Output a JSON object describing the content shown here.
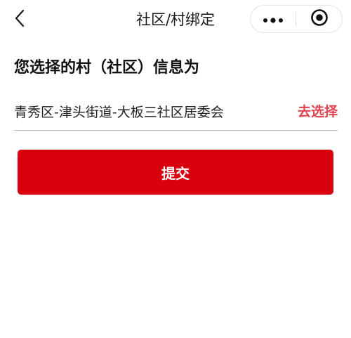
{
  "navbar": {
    "title": "社区/村绑定",
    "back_icon": "chevron-left-icon",
    "more_icon": "more-dots-icon",
    "close_icon": "target-circle-icon"
  },
  "binding": {
    "heading": "您选择的村（社区）信息为",
    "selected_value": "青秀区-津头街道-大板三社区居委会",
    "select_link": "去选择",
    "submit_label": "提交"
  },
  "colors": {
    "accent_red": "#d9000f",
    "link_red": "#e0424f",
    "text": "#111111"
  }
}
